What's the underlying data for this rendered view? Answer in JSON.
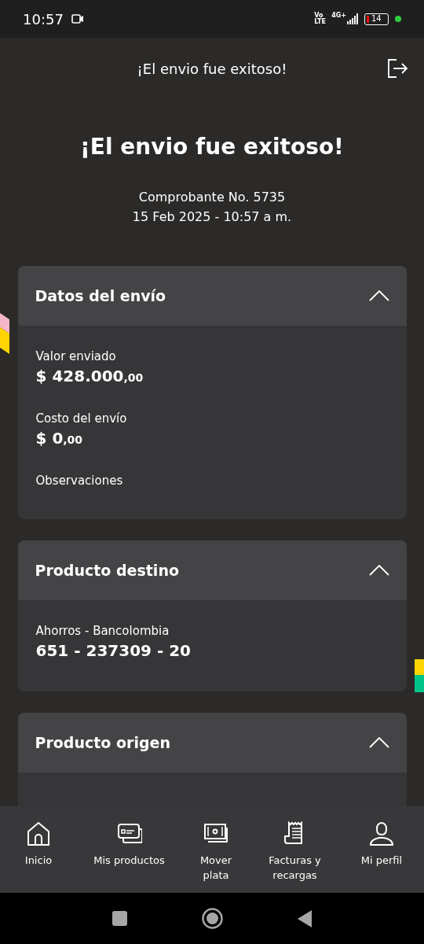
{
  "status_bar": {
    "time": "10:57",
    "network": "4G+",
    "volte_top": "Vo",
    "volte_bottom": "LTE",
    "battery": "14"
  },
  "header": {
    "title": "¡El envio fue exitoso!"
  },
  "headline": "¡El envio fue exitoso!",
  "receipt": {
    "number": "Comprobante No. 5735",
    "date": "15 Feb 2025 - 10:57 a m."
  },
  "sections": [
    {
      "title": "Datos del envío",
      "expanded": true,
      "fields": [
        {
          "label": "Valor enviado",
          "value": "$ 428.000",
          "cents": ",00"
        },
        {
          "label": "Costo del envío",
          "value": "$ 0",
          "cents": ",00"
        },
        {
          "label": "Observaciones"
        }
      ]
    },
    {
      "title": "Producto destino",
      "expanded": true,
      "fields": [
        {
          "label": "Ahorros - Bancolombia",
          "value": "651 - 237309 - 20"
        }
      ]
    },
    {
      "title": "Producto origen",
      "expanded": true
    }
  ],
  "bottom_nav": [
    {
      "label": "Inicio"
    },
    {
      "label": "Mis productos"
    },
    {
      "label": "Mover plata"
    },
    {
      "label": "Facturas y recargas"
    },
    {
      "label": "Mi perfil"
    }
  ]
}
